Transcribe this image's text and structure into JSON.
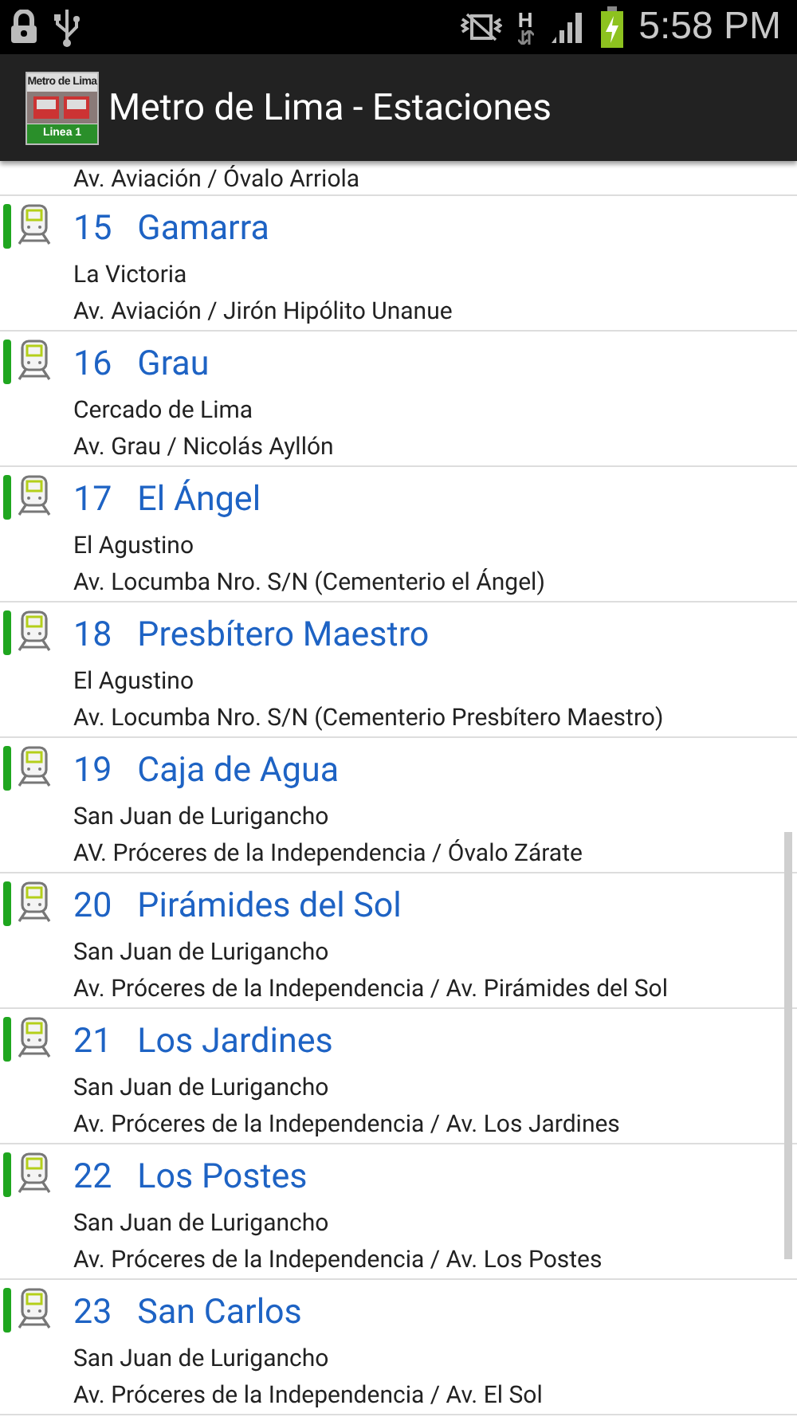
{
  "status_bar": {
    "network_type": "H",
    "battery": {
      "charging": true
    },
    "time": "5:58 PM"
  },
  "action_bar": {
    "logo": {
      "top_text": "Metro de Lima",
      "bottom_text": "Linea 1"
    },
    "title": "Metro de Lima - Estaciones"
  },
  "partial_row": {
    "address": "Av. Aviación / Óvalo Arriola"
  },
  "stations": [
    {
      "number": "15",
      "name": "Gamarra",
      "district": "La Victoria",
      "address": "Av. Aviación / Jirón Hipólito Unanue"
    },
    {
      "number": "16",
      "name": "Grau",
      "district": "Cercado de Lima",
      "address": "Av. Grau / Nicolás Ayllón"
    },
    {
      "number": "17",
      "name": "El Ángel",
      "district": "El Agustino",
      "address": "Av. Locumba Nro. S/N (Cementerio el Ángel)"
    },
    {
      "number": "18",
      "name": "Presbítero Maestro",
      "district": "El Agustino",
      "address": "Av. Locumba Nro. S/N (Cementerio Presbítero Maestro)"
    },
    {
      "number": "19",
      "name": "Caja de Agua",
      "district": "San Juan de Lurigancho",
      "address": "AV. Próceres de la Independencia / Óvalo Zárate"
    },
    {
      "number": "20",
      "name": "Pirámides del Sol",
      "district": "San Juan de Lurigancho",
      "address": "Av. Próceres de la Independencia / Av. Pirámides del Sol"
    },
    {
      "number": "21",
      "name": "Los Jardines",
      "district": "San Juan de Lurigancho",
      "address": "Av. Próceres de la Independencia / Av. Los Jardines"
    },
    {
      "number": "22",
      "name": "Los Postes",
      "district": "San Juan de Lurigancho",
      "address": "Av. Próceres de la Independencia / Av. Los Postes"
    },
    {
      "number": "23",
      "name": "San Carlos",
      "district": "San Juan de Lurigancho",
      "address": "Av. Próceres de la Independencia / Av. El Sol"
    }
  ]
}
